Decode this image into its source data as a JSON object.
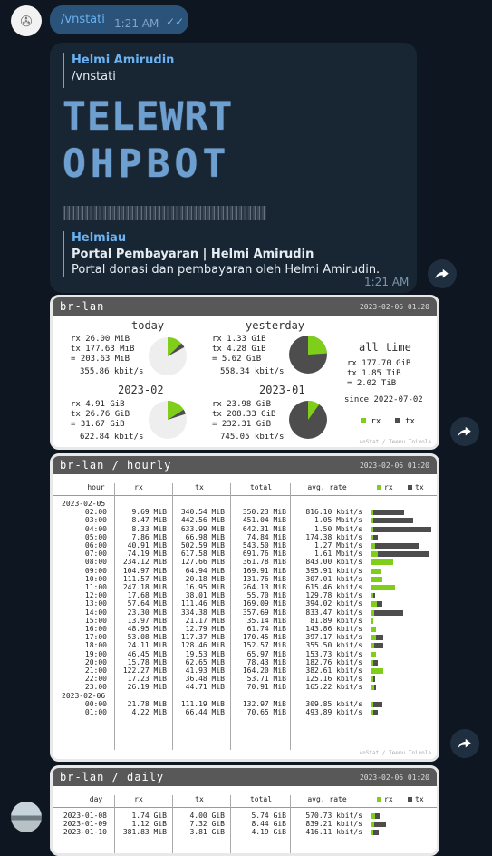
{
  "message1": {
    "text": "/vnstati",
    "time": "1:21 AM"
  },
  "message2": {
    "quote1": {
      "name": "Helmi Amirudin",
      "text": "/vnstati"
    },
    "banner": {
      "line1": "TELEWRT",
      "line2": "OHPBOT"
    },
    "quote2": {
      "name": "Helmiau",
      "title": "Portal Pembayaran | Helmi Amirudin",
      "desc": "Portal donasi dan pembayaran oleh Helmi Amirudin."
    },
    "time": "1:21 AM"
  },
  "summary": {
    "title": "br-lan",
    "date": "2023-02-06 01:20",
    "footer": "vnStat / Teemu Toivola",
    "today": {
      "label": "today",
      "rx": "rx 26.00 MiB",
      "tx": "tx 177.63 MiB",
      "total": "= 203.63 MiB",
      "rate": "355.86 kbit/s",
      "rx_frac": 0.13
    },
    "yesterday": {
      "label": "yesterday",
      "rx": "rx 1.33 GiB",
      "tx": "tx 4.28 GiB",
      "total": "= 5.62 GiB",
      "rate": "558.34 kbit/s",
      "rx_frac": 0.24
    },
    "month": {
      "label": "2023-02",
      "rx": "rx 4.91 GiB",
      "tx": "tx 26.76 GiB",
      "total": "= 31.67 GiB",
      "rate": "622.84 kbit/s",
      "rx_frac": 0.16
    },
    "prevmonth": {
      "label": "2023-01",
      "rx": "rx 23.98 GiB",
      "tx": "tx 208.33 GiB",
      "total": "= 232.31 GiB",
      "rate": "745.05 kbit/s",
      "rx_frac": 0.1
    },
    "alltime": {
      "label": "all time",
      "rx": "rx 177.70 GiB",
      "tx": "tx 1.85 TiB",
      "total": "= 2.02 TiB",
      "since": "since 2022-07-02",
      "legend_rx": "rx",
      "legend_tx": "tx"
    }
  },
  "hourly": {
    "title": "br-lan / hourly",
    "date": "2023-02-06 01:20",
    "footer": "vnStat / Teemu Toivola",
    "headers": [
      "hour",
      "rx",
      "tx",
      "total",
      "avg. rate"
    ],
    "legend_rx": "rx",
    "legend_tx": "tx",
    "rows": [
      {
        "h": "2023-02-05"
      },
      {
        "h": "02:00",
        "rx": "9.69 MiB",
        "tx": "340.54 MiB",
        "total": "350.23 MiB",
        "rate": "816.10 kbit/s",
        "r": 0.03,
        "t": 0.54
      },
      {
        "h": "03:00",
        "rx": "8.47 MiB",
        "tx": "442.56 MiB",
        "total": "451.04 MiB",
        "rate": "1.05 Mbit/s",
        "r": 0.02,
        "t": 0.7
      },
      {
        "h": "04:00",
        "rx": "8.33 MiB",
        "tx": "633.99 MiB",
        "total": "642.31 MiB",
        "rate": "1.50 Mbit/s",
        "r": 0.02,
        "t": 1.0
      },
      {
        "h": "05:00",
        "rx": "7.86 MiB",
        "tx": "66.98 MiB",
        "total": "74.84 MiB",
        "rate": "174.38 kbit/s",
        "r": 0.02,
        "t": 0.11
      },
      {
        "h": "06:00",
        "rx": "40.91 MiB",
        "tx": "502.59 MiB",
        "total": "543.50 MiB",
        "rate": "1.27 Mbit/s",
        "r": 0.06,
        "t": 0.79
      },
      {
        "h": "07:00",
        "rx": "74.19 MiB",
        "tx": "617.58 MiB",
        "total": "691.76 MiB",
        "rate": "1.61 Mbit/s",
        "r": 0.11,
        "t": 0.97
      },
      {
        "h": "08:00",
        "rx": "234.12 MiB",
        "tx": "127.66 MiB",
        "total": "361.78 MiB",
        "rate": "843.00 kbit/s",
        "r": 0.37,
        "t": 0.2
      },
      {
        "h": "09:00",
        "rx": "104.97 MiB",
        "tx": "64.94 MiB",
        "total": "169.91 MiB",
        "rate": "395.91 kbit/s",
        "r": 0.17,
        "t": 0.1
      },
      {
        "h": "10:00",
        "rx": "111.57 MiB",
        "tx": "20.18 MiB",
        "total": "131.76 MiB",
        "rate": "307.01 kbit/s",
        "r": 0.18,
        "t": 0.03
      },
      {
        "h": "11:00",
        "rx": "247.18 MiB",
        "tx": "16.95 MiB",
        "total": "264.13 MiB",
        "rate": "615.46 kbit/s",
        "r": 0.39,
        "t": 0.03
      },
      {
        "h": "12:00",
        "rx": "17.68 MiB",
        "tx": "38.01 MiB",
        "total": "55.70 MiB",
        "rate": "129.78 kbit/s",
        "r": 0.03,
        "t": 0.06
      },
      {
        "h": "13:00",
        "rx": "57.64 MiB",
        "tx": "111.46 MiB",
        "total": "169.09 MiB",
        "rate": "394.02 kbit/s",
        "r": 0.09,
        "t": 0.18
      },
      {
        "h": "14:00",
        "rx": "23.30 MiB",
        "tx": "334.38 MiB",
        "total": "357.69 MiB",
        "rate": "833.47 kbit/s",
        "r": 0.04,
        "t": 0.53
      },
      {
        "h": "15:00",
        "rx": "13.97 MiB",
        "tx": "21.17 MiB",
        "total": "35.14 MiB",
        "rate": "81.89 kbit/s",
        "r": 0.02,
        "t": 0.03
      },
      {
        "h": "16:00",
        "rx": "48.95 MiB",
        "tx": "12.79 MiB",
        "total": "61.74 MiB",
        "rate": "143.86 kbit/s",
        "r": 0.08,
        "t": 0.02
      },
      {
        "h": "17:00",
        "rx": "53.08 MiB",
        "tx": "117.37 MiB",
        "total": "170.45 MiB",
        "rate": "397.17 kbit/s",
        "r": 0.08,
        "t": 0.19
      },
      {
        "h": "18:00",
        "rx": "24.11 MiB",
        "tx": "128.46 MiB",
        "total": "152.57 MiB",
        "rate": "355.50 kbit/s",
        "r": 0.04,
        "t": 0.2
      },
      {
        "h": "19:00",
        "rx": "46.45 MiB",
        "tx": "19.53 MiB",
        "total": "65.97 MiB",
        "rate": "153.73 kbit/s",
        "r": 0.07,
        "t": 0.03
      },
      {
        "h": "20:00",
        "rx": "15.78 MiB",
        "tx": "62.65 MiB",
        "total": "78.43 MiB",
        "rate": "182.76 kbit/s",
        "r": 0.02,
        "t": 0.1
      },
      {
        "h": "21:00",
        "rx": "122.27 MiB",
        "tx": "41.93 MiB",
        "total": "164.20 MiB",
        "rate": "382.61 kbit/s",
        "r": 0.19,
        "t": 0.07
      },
      {
        "h": "22:00",
        "rx": "17.23 MiB",
        "tx": "36.48 MiB",
        "total": "53.71 MiB",
        "rate": "125.16 kbit/s",
        "r": 0.03,
        "t": 0.06
      },
      {
        "h": "23:00",
        "rx": "26.19 MiB",
        "tx": "44.71 MiB",
        "total": "70.91 MiB",
        "rate": "165.22 kbit/s",
        "r": 0.04,
        "t": 0.07
      },
      {
        "h": "2023-02-06"
      },
      {
        "h": "00:00",
        "rx": "21.78 MiB",
        "tx": "111.19 MiB",
        "total": "132.97 MiB",
        "rate": "309.85 kbit/s",
        "r": 0.03,
        "t": 0.18
      },
      {
        "h": "01:00",
        "rx": "4.22 MiB",
        "tx": "66.44 MiB",
        "total": "70.65 MiB",
        "rate": "493.89 kbit/s",
        "r": 0.01,
        "t": 0.1
      }
    ]
  },
  "daily": {
    "title": "br-lan / daily",
    "date": "2023-02-06 01:20",
    "headers": [
      "day",
      "rx",
      "tx",
      "total",
      "avg. rate"
    ],
    "legend_rx": "rx",
    "legend_tx": "tx",
    "rows": [
      {
        "h": "2023-01-08",
        "rx": "1.74 GiB",
        "tx": "4.00 GiB",
        "total": "5.74 GiB",
        "rate": "570.73 kbit/s",
        "r": 0.06,
        "t": 0.13
      },
      {
        "h": "2023-01-09",
        "rx": "1.12 GiB",
        "tx": "7.32 GiB",
        "total": "8.44 GiB",
        "rate": "839.21 kbit/s",
        "r": 0.04,
        "t": 0.24
      },
      {
        "h": "2023-01-10",
        "rx": "381.83 MiB",
        "tx": "3.81 GiB",
        "total": "4.19 GiB",
        "rate": "416.11 kbit/s",
        "r": 0.01,
        "t": 0.12
      }
    ]
  },
  "colors": {
    "rx": "#7fcf1a",
    "tx": "#4d4d4d",
    "bg": "#0e1621",
    "bubble": "#182533",
    "outgoing": "#2b5278",
    "link": "#6ab2f2"
  }
}
